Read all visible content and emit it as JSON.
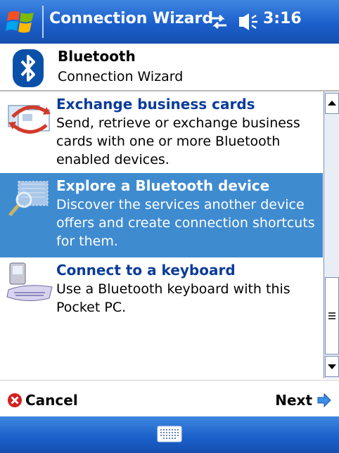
{
  "titlebar": {
    "title": "Connection Wizard",
    "time": "3:16"
  },
  "header": {
    "title": "Bluetooth",
    "subtitle": "Connection Wizard"
  },
  "list": {
    "items": [
      {
        "title": "Exchange business cards",
        "description": "Send, retrieve or exchange business cards with one or more Bluetooth enabled devices.",
        "selected": false
      },
      {
        "title": "Explore a Bluetooth device",
        "description": "Discover the services another device offers and create connection shortcuts for them.",
        "selected": true
      },
      {
        "title": "Connect to a keyboard",
        "description": "Use a Bluetooth keyboard with this Pocket PC.",
        "selected": false
      }
    ]
  },
  "commands": {
    "cancel": "Cancel",
    "next": "Next"
  },
  "colors": {
    "accent_blue": "#1b5fcb",
    "selection": "#3f8bd0",
    "item_title": "#0b3c99"
  }
}
